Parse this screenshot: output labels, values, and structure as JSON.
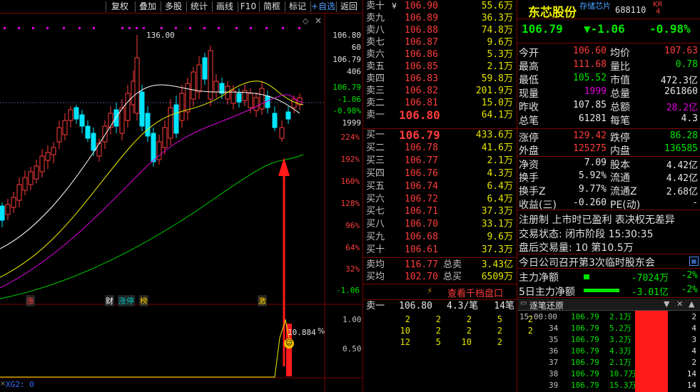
{
  "toolbar": [
    "复权",
    "叠加",
    "多股",
    "统计",
    "画线",
    "F10",
    "简框",
    "标记",
    "+自选",
    "返回"
  ],
  "chart": {
    "high_label": "136.00",
    "axis_price": [
      "106.80",
      "60",
      "106.79",
      "406",
      "106.79",
      "-1.06",
      "-0.98%",
      "1999"
    ],
    "axis_pct": [
      "224%",
      "192%",
      "160%",
      "128%",
      "96%",
      "64%",
      "32%",
      "-1.06"
    ],
    "event_tags": [
      "涨",
      "财",
      "涨停",
      "榜",
      "激"
    ],
    "indicator_value": "10.884",
    "indicator_unit": "%",
    "indicator_axis": [
      "1.00",
      "0.50"
    ],
    "indicator_name": "XG2: 0",
    "settings_icon": "diamond-icon",
    "close_icon": "close-icon"
  },
  "order_book": {
    "asks": [
      {
        "label": "卖十",
        "price": "106.90",
        "vol": "55.6万",
        "mark": "¥"
      },
      {
        "label": "卖九",
        "price": "106.89",
        "vol": "36.3万",
        "mark": ""
      },
      {
        "label": "卖八",
        "price": "106.88",
        "vol": "74.8万",
        "mark": ""
      },
      {
        "label": "卖七",
        "price": "106.87",
        "vol": "9.6万",
        "mark": ""
      },
      {
        "label": "卖六",
        "price": "106.86",
        "vol": "5.3万",
        "mark": ""
      },
      {
        "label": "卖五",
        "price": "106.85",
        "vol": "2.1万",
        "mark": ""
      },
      {
        "label": "卖四",
        "price": "106.83",
        "vol": "59.8万",
        "mark": ""
      },
      {
        "label": "卖三",
        "price": "106.82",
        "vol": "201.9万",
        "mark": ""
      },
      {
        "label": "卖二",
        "price": "106.81",
        "vol": "15.0万",
        "mark": ""
      },
      {
        "label": "卖一",
        "price": "106.80",
        "vol": "64.1万",
        "mark": ""
      }
    ],
    "bids": [
      {
        "label": "买一",
        "price": "106.79",
        "vol": "433.6万"
      },
      {
        "label": "买二",
        "price": "106.78",
        "vol": "41.6万"
      },
      {
        "label": "买三",
        "price": "106.77",
        "vol": "2.1万"
      },
      {
        "label": "买四",
        "price": "106.76",
        "vol": "4.3万"
      },
      {
        "label": "买五",
        "price": "106.74",
        "vol": "6.4万"
      },
      {
        "label": "买六",
        "price": "106.72",
        "vol": "6.4万"
      },
      {
        "label": "买七",
        "price": "106.71",
        "vol": "37.3万"
      },
      {
        "label": "买八",
        "price": "106.70",
        "vol": "33.1万"
      },
      {
        "label": "买九",
        "price": "106.68",
        "vol": "9.6万"
      },
      {
        "label": "买十",
        "price": "106.61",
        "vol": "37.3万"
      }
    ],
    "avg_ask": {
      "label": "卖均",
      "price": "116.77",
      "name": "总卖",
      "vol": "3.43亿"
    },
    "avg_bid": {
      "label": "买均",
      "price": "102.70",
      "name": "总买",
      "vol": "6509万"
    },
    "view_level_link": "查看千档盘口",
    "queue": {
      "label": "卖一",
      "price": "106.80",
      "vol": "4.3/笔",
      "count": "14笔",
      "rows": [
        [
          "2",
          "2",
          "2",
          "5",
          "2"
        ],
        [
          "10",
          "2",
          "2",
          "2",
          "2"
        ],
        [
          "12",
          "5",
          "10",
          "2",
          ""
        ]
      ]
    }
  },
  "stock": {
    "name": "东芯股份",
    "tag": "存储芯片",
    "code": "688110",
    "badge_top": "KR",
    "badge_bottom": "4",
    "price": "106.79",
    "change": "▼-1.06",
    "change_pct": "-0.98%"
  },
  "quote": [
    [
      {
        "k": "今开",
        "v": "106.60",
        "c": "red"
      },
      {
        "k": "均价",
        "v": "107.63",
        "c": "red"
      }
    ],
    [
      {
        "k": "最高",
        "v": "111.68",
        "c": "red"
      },
      {
        "k": "量比",
        "v": "0.78",
        "c": "green"
      }
    ],
    [
      {
        "k": "最低",
        "v": "105.52",
        "c": "green"
      },
      {
        "k": "市值",
        "v": "472.3亿",
        "c": "white"
      }
    ],
    [
      {
        "k": "现量",
        "v": "1999",
        "c": "purple"
      },
      {
        "k": "总量",
        "v": "261860",
        "c": "white"
      }
    ],
    [
      {
        "k": "昨收",
        "v": "107.85",
        "c": "white"
      },
      {
        "k": "总额",
        "v": "28.2亿",
        "c": "purple"
      }
    ],
    [
      {
        "k": "总笔",
        "v": "61281",
        "c": "white"
      },
      {
        "k": "每笔",
        "v": "4.3",
        "c": "white"
      }
    ],
    [
      {
        "k": "涨停",
        "v": "129.42",
        "c": "red"
      },
      {
        "k": "跌停",
        "v": "86.28",
        "c": "green"
      }
    ],
    [
      {
        "k": "外盘",
        "v": "125275",
        "c": "red"
      },
      {
        "k": "内盘",
        "v": "136585",
        "c": "green"
      }
    ],
    [
      {
        "k": "净资",
        "v": "7.09",
        "c": "white"
      },
      {
        "k": "股本",
        "v": "4.42亿",
        "c": "white"
      }
    ],
    [
      {
        "k": "换手",
        "v": "5.92%",
        "c": "white"
      },
      {
        "k": "流通",
        "v": "4.42亿",
        "c": "white"
      }
    ],
    [
      {
        "k": "换手Z",
        "v": "9.77%",
        "c": "white"
      },
      {
        "k": "流通Z",
        "v": "2.68亿",
        "c": "white"
      }
    ],
    [
      {
        "k": "收益(三)",
        "v": "-0.260",
        "c": "white"
      },
      {
        "k": "PE(动)",
        "v": "-",
        "c": "white"
      }
    ]
  ],
  "info": {
    "flags": "注册制 上市时已盈利 表决权无差异",
    "status": "交易状态: 闭市阶段 15:30:35",
    "after_hours": "盘后交易量: 10  第10.5万",
    "news": "今日公司召开第3次临时股东会",
    "news_icon": "calendar-icon"
  },
  "flow": [
    {
      "label": "主力净额",
      "value": "-7024万",
      "pct": "-2%",
      "bar_fraction": 0.08
    },
    {
      "label": "5日主力净额",
      "value": "-3.01亿",
      "pct": "-2%",
      "bar_fraction": 0.5
    }
  ],
  "ticks": {
    "title": "逐笔还原",
    "rows": [
      {
        "time": "15:00:00",
        "price": "106.79",
        "vol": "2.1万",
        "n": "2"
      },
      {
        "time": "34",
        "price": "106.79",
        "vol": "5.2万",
        "n": "4"
      },
      {
        "time": "35",
        "price": "106.79",
        "vol": "3.2万",
        "n": "3"
      },
      {
        "time": "36",
        "price": "106.79",
        "vol": "4.3万",
        "n": "4"
      },
      {
        "time": "37",
        "price": "106.79",
        "vol": "2.1万",
        "n": "2"
      },
      {
        "time": "38",
        "price": "106.79",
        "vol": "10.7万",
        "n": "14"
      },
      {
        "time": "39",
        "price": "106.79",
        "vol": "15.3万",
        "n": "14"
      }
    ]
  },
  "colors": {
    "up": "#ff3c3c",
    "down": "#00e600",
    "border": "#7a0000",
    "cyan": "#00e5ff"
  }
}
